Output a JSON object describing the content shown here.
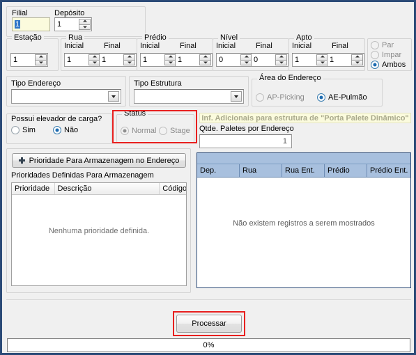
{
  "window": {
    "bg": "#f0f0f0",
    "border_color": "#2b4a77"
  },
  "top": {
    "filial": {
      "label": "Filial",
      "value": "1"
    },
    "deposito": {
      "label": "Depósito",
      "value": "1"
    }
  },
  "ranges": {
    "estacao": {
      "title": "Estação",
      "value": "1"
    },
    "rua": {
      "title": "Rua",
      "inicial_label": "Inicial",
      "final_label": "Final",
      "inicial": "1",
      "final": "1"
    },
    "predio": {
      "title": "Prédio",
      "inicial_label": "Inicial",
      "final_label": "Final",
      "inicial": "1",
      "final": "1"
    },
    "nivel": {
      "title": "Nível",
      "inicial_label": "Inicial",
      "final_label": "Final",
      "inicial": "0",
      "final": "0"
    },
    "apto": {
      "title": "Apto",
      "inicial_label": "Inicial",
      "final_label": "Final",
      "inicial": "1",
      "final": "1"
    }
  },
  "parity": {
    "options": [
      "Par",
      "Impar",
      "Ambos"
    ],
    "selected": "Ambos",
    "disabled": [
      true,
      true,
      false
    ]
  },
  "tipo_endereco": {
    "label": "Tipo Endereço",
    "value": ""
  },
  "tipo_estrutura": {
    "label": "Tipo Estrutura",
    "value": ""
  },
  "area_endereco": {
    "title": "Área do Endereço",
    "options": [
      "AP-Picking",
      "AE-Pulmão"
    ],
    "selected": "AE-Pulmão"
  },
  "elevador": {
    "question": "Possui elevador de carga?",
    "options": [
      "Sim",
      "Não"
    ],
    "selected": "Não"
  },
  "status": {
    "title": "Status",
    "options": [
      "Normal",
      "Stage"
    ],
    "selected": "Normal",
    "disabled": true,
    "highlight_color": "#e8201f"
  },
  "inf_adicionais": {
    "banner": "Inf. Adicionais para estrutura de \"Porta Palete Dinâmico\"",
    "qtde_label": "Qtde. Paletes por Endereço",
    "qtde_value": "1"
  },
  "prioridade": {
    "button_label": "Prioridade Para Armazenagem no Endereço",
    "button_icon": "plus-icon",
    "list_label": "Prioridades Definidas Para Armazenagem",
    "columns": [
      "Prioridade",
      "Descrição",
      "Código"
    ],
    "rows": [],
    "empty_text": "Nenhuma prioridade definida."
  },
  "data_grid": {
    "columns": [
      "Dep.",
      "Rua",
      "Rua Ent.",
      "Prédio",
      "Prédio Ent."
    ],
    "rows": [],
    "empty_text": "Não existem registros a serem mostrados"
  },
  "footer": {
    "process_button": "Processar",
    "process_highlight_color": "#e8201f",
    "progress_text": "0%",
    "progress_percent": 0
  }
}
